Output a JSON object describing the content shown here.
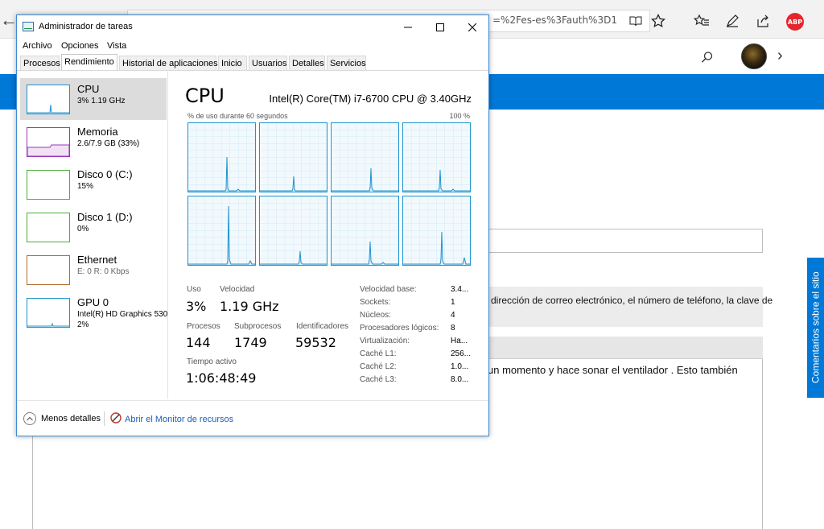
{
  "browser": {
    "address_text": "=%2Fes-es%3Fauth%3D1",
    "icons": [
      "back-arrow-icon",
      "reading-view-icon",
      "favorite-star-icon",
      "favorites-hub-icon",
      "web-note-icon",
      "share-icon",
      "adblock-plus-icon"
    ],
    "abp_label": "ABP"
  },
  "site": {
    "contact_text": "a dirección de correo electrónico, el número de teléfono, la clave de",
    "post_text": "un momento y hace sonar el ventilador . Esto también",
    "feedback_label": "Comentarios sobre el sitio",
    "accent_color": "#0078d7"
  },
  "taskmgr": {
    "title": "Administrador de tareas",
    "menu": [
      "Archivo",
      "Opciones",
      "Vista"
    ],
    "tabs": [
      "Procesos",
      "Rendimiento",
      "Historial de aplicaciones",
      "Inicio",
      "Usuarios",
      "Detalles",
      "Servicios"
    ],
    "active_tab": "Rendimiento",
    "sidebar": [
      {
        "name": "CPU",
        "sub": "3% 1.19 GHz",
        "sub2": "",
        "color": "#1e93d0"
      },
      {
        "name": "Memoria",
        "sub": "2.6/7.9 GB (33%)",
        "sub2": "",
        "color": "#9b36b8"
      },
      {
        "name": "Disco 0 (C:)",
        "sub": "15%",
        "sub2": "",
        "color": "#4caf3a"
      },
      {
        "name": "Disco 1 (D:)",
        "sub": "0%",
        "sub2": "",
        "color": "#4caf3a"
      },
      {
        "name": "Ethernet",
        "sub": "E: 0 R: 0 Kbps",
        "sub2": "",
        "color": "#b56b2a"
      },
      {
        "name": "GPU 0",
        "sub": "Intel(R) HD Graphics 530",
        "sub2": "2%",
        "color": "#1e93d0"
      }
    ],
    "main": {
      "title": "CPU",
      "model": "Intel(R) Core(TM) i7-6700 CPU @ 3.40GHz",
      "graph_caption": "% de uso durante 60 segundos",
      "graph_max": "100 %",
      "stats": {
        "uso_label": "Uso",
        "uso": "3%",
        "velocidad_label": "Velocidad",
        "velocidad": "1.19 GHz",
        "procesos_label": "Procesos",
        "procesos": "144",
        "subprocesos_label": "Subprocesos",
        "subprocesos": "1749",
        "identificadores_label": "Identificadores",
        "identificadores": "59532",
        "tiempo_label": "Tiempo activo",
        "tiempo": "1:06:48:49"
      },
      "specs": [
        {
          "label": "Velocidad base:",
          "value": "3.4..."
        },
        {
          "label": "Sockets:",
          "value": "1"
        },
        {
          "label": "Núcleos:",
          "value": "4"
        },
        {
          "label": "Procesadores lógicos:",
          "value": "8"
        },
        {
          "label": "Virtualización:",
          "value": "Ha..."
        },
        {
          "label": "Caché L1:",
          "value": "256..."
        },
        {
          "label": "Caché L2:",
          "value": "1.0..."
        },
        {
          "label": "Caché L3:",
          "value": "8.0..."
        }
      ]
    },
    "footer": {
      "fewer_details": "Menos detalles",
      "resource_monitor": "Abrir el Monitor de recursos"
    }
  }
}
